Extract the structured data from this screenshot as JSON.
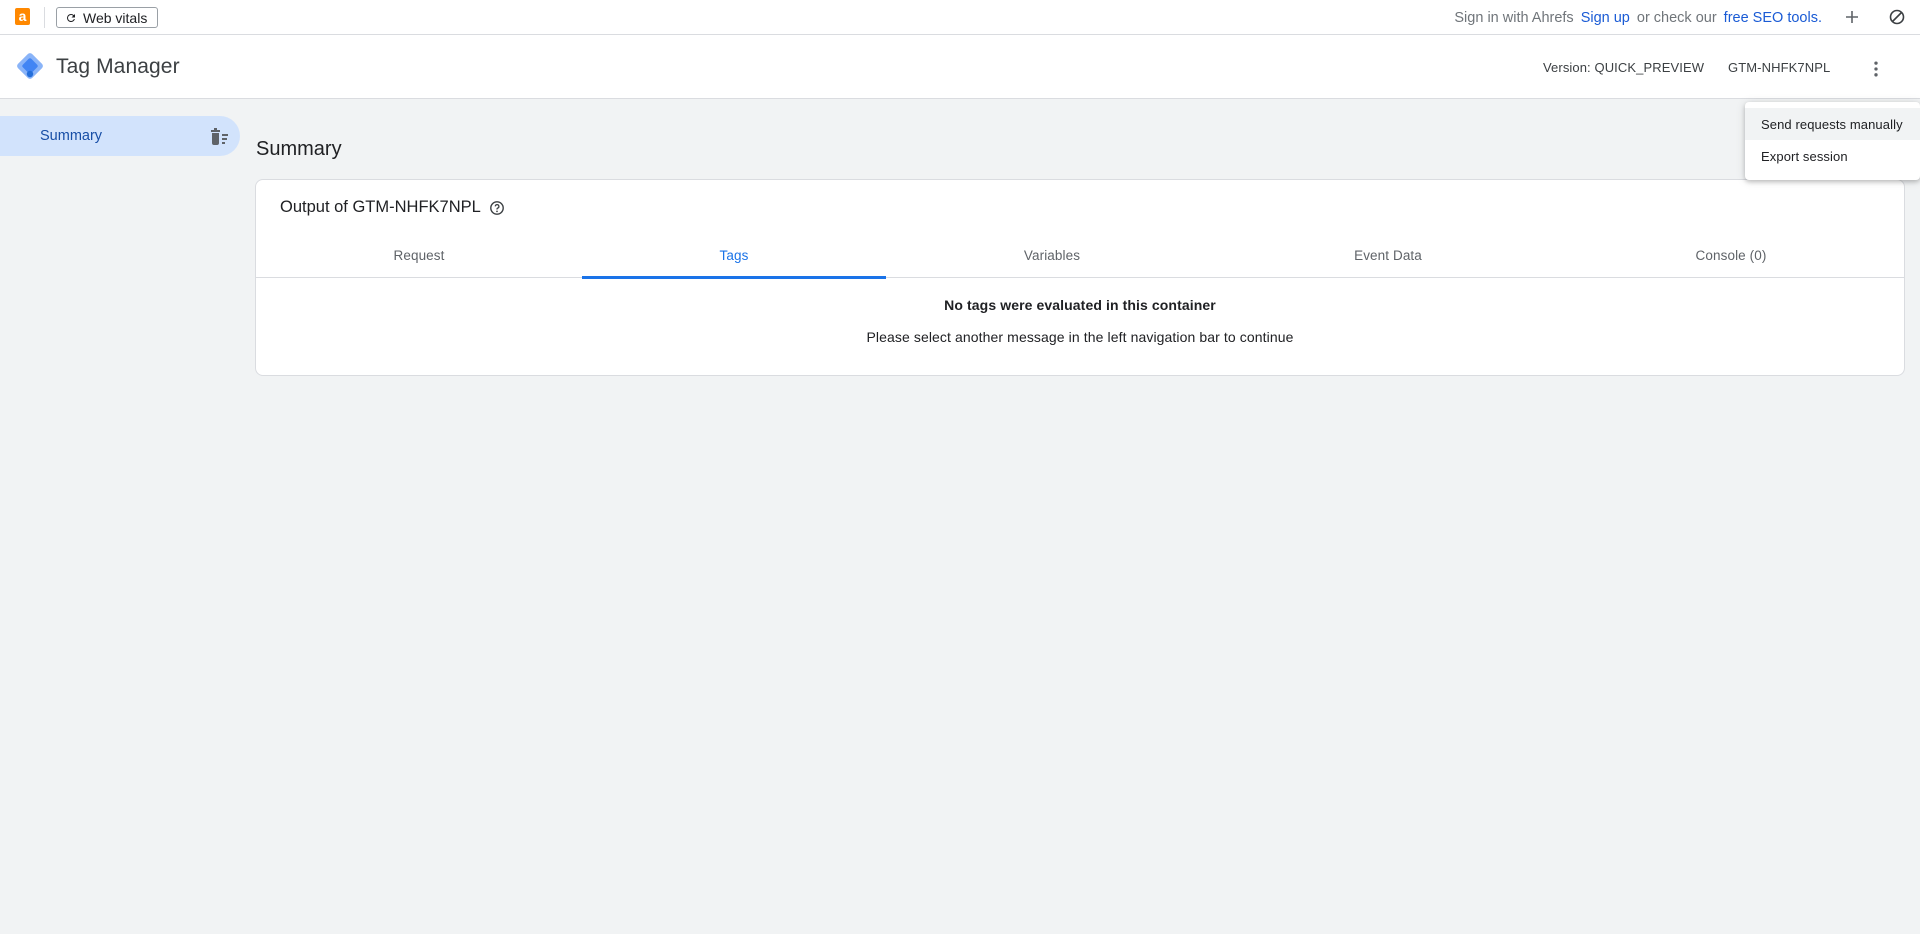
{
  "extension_bar": {
    "logo_letter": "a",
    "web_vitals_label": "Web vitals",
    "sign_in_text": "Sign in with Ahrefs",
    "sign_up_link": "Sign up",
    "or_check_text": "or check our",
    "free_tools_link": "free SEO tools.",
    "brand_color": "#ff8800"
  },
  "header": {
    "app_title": "Tag Manager",
    "version_label": "Version: QUICK_PREVIEW",
    "container_id": "GTM-NHFK7NPL"
  },
  "sidebar": {
    "items": [
      {
        "label": "Summary",
        "selected": true
      }
    ]
  },
  "main": {
    "page_title": "Summary",
    "card_title": "Output of GTM-NHFK7NPL",
    "tabs": [
      {
        "label": "Request",
        "active": false
      },
      {
        "label": "Tags",
        "active": true
      },
      {
        "label": "Variables",
        "active": false
      },
      {
        "label": "Event Data",
        "active": false
      },
      {
        "label": "Console (0)",
        "active": false
      }
    ],
    "empty_title": "No tags were evaluated in this container",
    "empty_subtitle": "Please select another message in the left navigation bar to continue"
  },
  "menu": {
    "items": [
      {
        "label": "Send requests manually"
      },
      {
        "label": "Export session"
      }
    ]
  },
  "colors": {
    "accent": "#1a73e8",
    "selected_bg": "#d2e3fc",
    "page_bg": "#f1f3f4"
  }
}
